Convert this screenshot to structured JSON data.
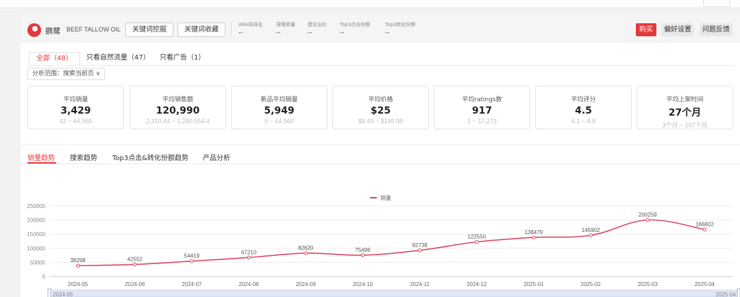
{
  "header": {
    "brand": "鹦鹭",
    "keyword": "BEEF TALLOW OIL",
    "btn_mine": "关键词挖掘",
    "btn_fav": "关键词收藏",
    "metrics": [
      {
        "label": "ABA周排名",
        "value": "--"
      },
      {
        "label": "周搜索量",
        "value": "--"
      },
      {
        "label": "建议出价",
        "value": "--"
      },
      {
        "label": "Top3点击份额",
        "value": "--"
      },
      {
        "label": "Top3转化份额",
        "value": "--"
      }
    ],
    "buy": "购买",
    "prefs": "偏好设置",
    "feedback": "问题反馈"
  },
  "tabs": [
    "全部（48）",
    "只看自然流量（47）",
    "只看广告（1）"
  ],
  "scope": "分析范围：搜索当前页 ∨",
  "cards": [
    {
      "label": "平均销量",
      "value": "3,429",
      "range": "42 ~ 64,560"
    },
    {
      "label": "平均销售额",
      "value": "120,990",
      "range": "2,310.44 ~ 1,290,554.4"
    },
    {
      "label": "新品平均销量",
      "value": "5,949",
      "range": "0 ~ 64,560"
    },
    {
      "label": "平均价格",
      "value": "$25",
      "range": "$8.49 ~ $149.99"
    },
    {
      "label": "平均ratings数",
      "value": "917",
      "range": "1 ~ 17,273"
    },
    {
      "label": "平均评分",
      "value": "4.5",
      "range": "4.1 ~ 4.8"
    },
    {
      "label": "平均上架时间",
      "value": "27个月",
      "range": "3个月 ~ 107个月"
    }
  ],
  "section_tabs": [
    "销量趋势",
    "搜索趋势",
    "Top3点击&转化份额趋势",
    "产品分析"
  ],
  "colors": {
    "accent": "#e4393c",
    "line": "#d9455f",
    "slider": "#dfe6f5"
  },
  "chart_data": {
    "type": "line",
    "categories": [
      "2024-05",
      "2024-06",
      "2024-07",
      "2024-08",
      "2024-09",
      "2024-10",
      "2024-11",
      "2024-12",
      "2025-01",
      "2025-02",
      "2025-03",
      "2025-04"
    ],
    "series": [
      {
        "name": "销量",
        "values": [
          38298,
          42552,
          54419,
          67210,
          82620,
          75496,
          92738,
          122550,
          138479,
          145902,
          200259,
          166602
        ]
      }
    ],
    "y_ticks": [
      0,
      50000,
      100000,
      150000,
      200000,
      250000
    ],
    "ylim": [
      0,
      250000
    ],
    "legend": "top-center",
    "grid": true,
    "slider": {
      "start": "2024-05",
      "end": "2025-04"
    }
  }
}
